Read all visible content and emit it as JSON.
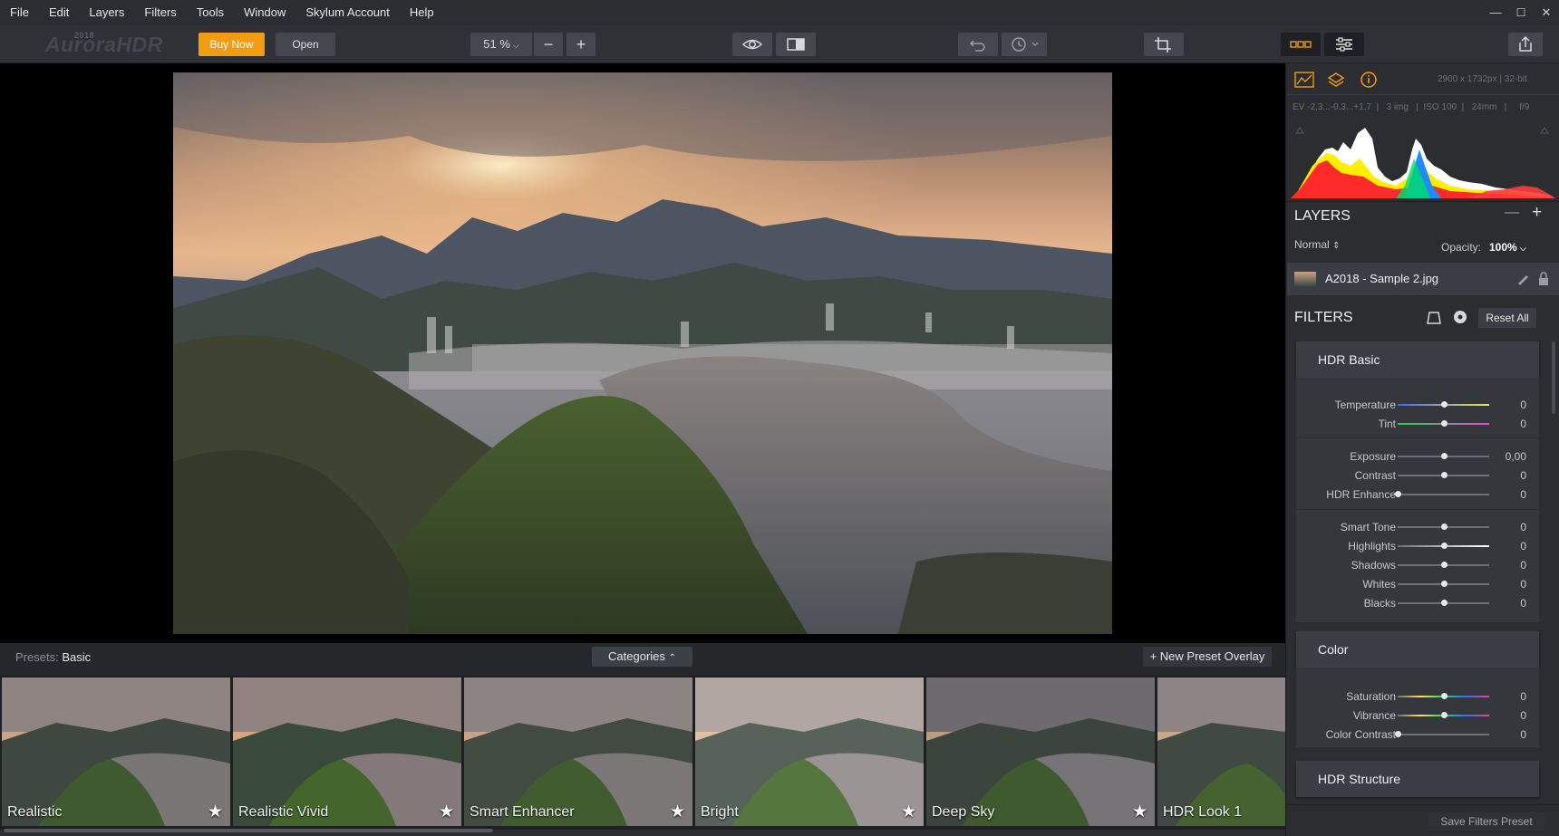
{
  "menu": {
    "items": [
      "File",
      "Edit",
      "Layers",
      "Filters",
      "Tools",
      "Window",
      "Skylum Account",
      "Help"
    ]
  },
  "window_controls": {
    "minimize": "—",
    "maximize": "☐",
    "close": "✕"
  },
  "toolbar": {
    "logo": "AuroraHDR",
    "logo_year": "2018",
    "buy_label": "Buy Now",
    "open_label": "Open",
    "zoom": "51 %",
    "icons": [
      "eye-icon",
      "compare-icon",
      "undo-icon",
      "history-icon",
      "crop-icon",
      "presets-view-icon",
      "adjustments-icon",
      "share-icon"
    ],
    "accent": "#f39c12"
  },
  "info": {
    "dimensions": "2900 x 1732px | 32-bit",
    "exif": "EV -2,3...-0,3...+1,7  |   3 img   |  ISO 100  |   24mm   |     f/9"
  },
  "layers": {
    "title": "LAYERS",
    "blend_mode": "Normal",
    "opacity_label": "Opacity:",
    "opacity_value": "100%",
    "layer_name": "A2018 - Sample 2.jpg"
  },
  "filters": {
    "title": "FILTERS",
    "reset_label": "Reset All",
    "hdr_basic": {
      "title": "HDR Basic",
      "sliders": [
        {
          "label": "Temperature",
          "value": "0",
          "pos": 0.5
        },
        {
          "label": "Tint",
          "value": "0",
          "pos": 0.5
        },
        {
          "label": "Exposure",
          "value": "0,00",
          "pos": 0.5
        },
        {
          "label": "Contrast",
          "value": "0",
          "pos": 0.5
        },
        {
          "label": "HDR Enhance",
          "value": "0",
          "pos": 0.0
        },
        {
          "label": "Smart Tone",
          "value": "0",
          "pos": 0.5
        },
        {
          "label": "Highlights",
          "value": "0",
          "pos": 0.5
        },
        {
          "label": "Shadows",
          "value": "0",
          "pos": 0.5
        },
        {
          "label": "Whites",
          "value": "0",
          "pos": 0.5
        },
        {
          "label": "Blacks",
          "value": "0",
          "pos": 0.5
        }
      ]
    },
    "color": {
      "title": "Color",
      "sliders": [
        {
          "label": "Saturation",
          "value": "0",
          "pos": 0.5
        },
        {
          "label": "Vibrance",
          "value": "0",
          "pos": 0.5
        },
        {
          "label": "Color Contrast",
          "value": "0",
          "pos": 0.0
        }
      ]
    },
    "hdr_structure": {
      "title": "HDR Structure"
    },
    "save_label": "Save Filters Preset"
  },
  "presets": {
    "label": "Presets:",
    "category": "Basic",
    "categories_label": "Categories",
    "new_overlay_label": "+ New Preset Overlay",
    "items": [
      {
        "name": "Realistic",
        "starred": true
      },
      {
        "name": "Realistic Vivid",
        "starred": true
      },
      {
        "name": "Smart Enhancer",
        "starred": true
      },
      {
        "name": "Bright",
        "starred": true
      },
      {
        "name": "Deep Sky",
        "starred": true
      },
      {
        "name": "HDR Look 1",
        "starred": false
      }
    ]
  }
}
